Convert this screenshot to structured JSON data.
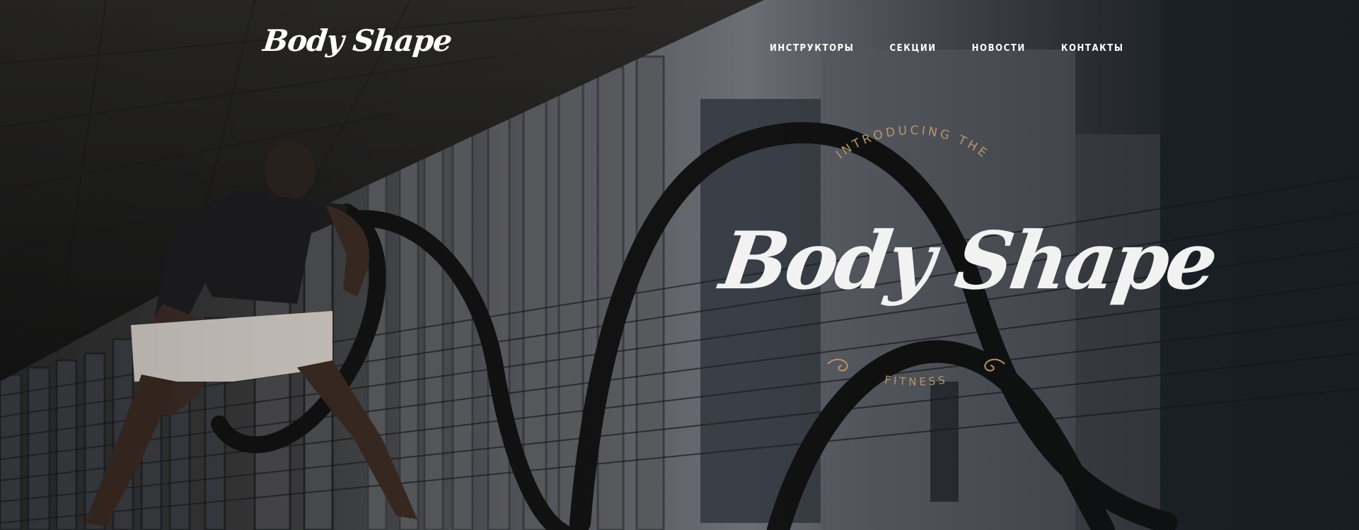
{
  "header": {
    "logo_text": "Body Shape",
    "nav": [
      {
        "label": "ИНСТРУКТОРЫ"
      },
      {
        "label": "СЕКЦИИ"
      },
      {
        "label": "НОВОСТИ"
      },
      {
        "label": "КОНТАКТЫ"
      }
    ]
  },
  "hero": {
    "emblem_top": "INTRODUCING THE",
    "emblem_title": "Body Shape",
    "emblem_bottom": "FITNESS",
    "accent_color": "#b8956a"
  }
}
